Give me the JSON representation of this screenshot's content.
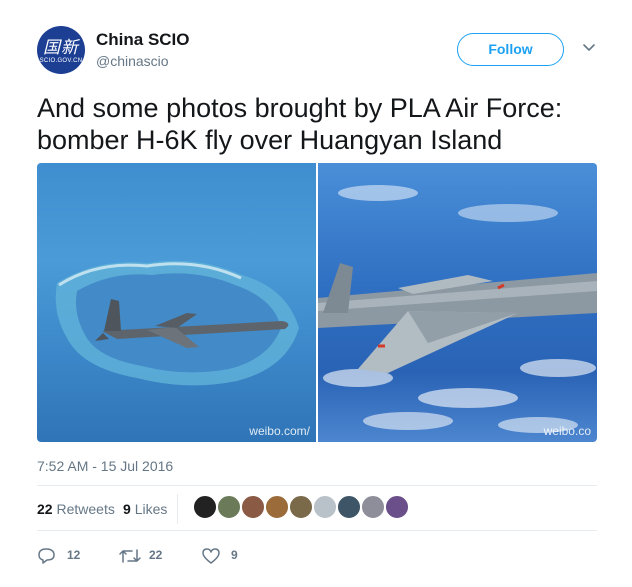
{
  "author": {
    "display_name": "China SCIO",
    "handle": "@chinascio",
    "avatar_glyphs": "国新",
    "avatar_subtext": "SCIO.GOV.CN"
  },
  "follow_label": "Follow",
  "tweet": {
    "text": "And some photos brought by PLA Air Force: bomber H-6K fly over Huangyan Island",
    "timestamp": "7:52 AM - 15 Jul 2016"
  },
  "photos": [
    {
      "watermark": "weibo.com/"
    },
    {
      "watermark": "weibo.co"
    }
  ],
  "stats": {
    "retweets_count": "22",
    "retweets_label": "Retweets",
    "likes_count": "9",
    "likes_label": "Likes"
  },
  "likers": [
    {
      "color": "#222222"
    },
    {
      "color": "#6b7b5a"
    },
    {
      "color": "#8a5a44"
    },
    {
      "color": "#9c6b3a"
    },
    {
      "color": "#7a6a4a"
    },
    {
      "color": "#b9c2c8"
    },
    {
      "color": "#3d5566"
    },
    {
      "color": "#8e8e9a"
    },
    {
      "color": "#6a4f8a"
    }
  ],
  "actions": {
    "reply_count": "12",
    "retweet_count": "22",
    "like_count": "9"
  },
  "colors": {
    "accent": "#1da1f2",
    "text_primary": "#14171a",
    "text_secondary": "#657786"
  }
}
